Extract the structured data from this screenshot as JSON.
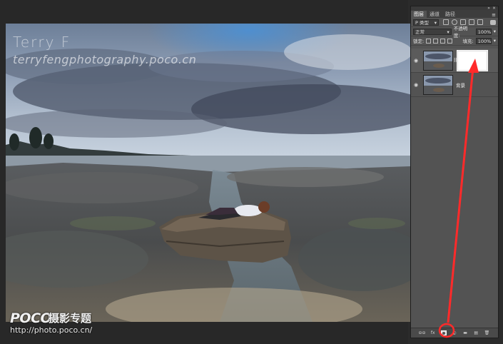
{
  "watermark": {
    "name": "Terry F",
    "url": "terryfengphotography.poco.cn"
  },
  "site_logo": {
    "brand": "POCO",
    "subtitle": "摄影专题",
    "url": "http://photo.poco.cn/"
  },
  "layers_panel": {
    "tabs": [
      "图层",
      "通道",
      "路径"
    ],
    "active_tab": "图层",
    "filter": {
      "kind_label": "P 类型"
    },
    "blend_mode": "正常",
    "opacity_label": "不透明度:",
    "opacity_value": "100%",
    "lock_label": "锁定:",
    "fill_label": "填充:",
    "fill_value": "100%",
    "layers": [
      {
        "name": "",
        "has_mask": true,
        "selected": true
      },
      {
        "name": "背景",
        "has_mask": false,
        "selected": false
      }
    ],
    "bottom_buttons": [
      "link-layers",
      "fx",
      "add-layer-mask",
      "adjustment-layer",
      "new-group",
      "new-layer",
      "delete-layer"
    ],
    "bottom_glyphs": [
      "⊖⊖",
      "fx",
      "",
      "◐",
      "▬",
      "▤",
      "🗑"
    ]
  },
  "colors": {
    "annotation_red": "#ff2a2a",
    "panel_bg": "#535353"
  },
  "icons": {
    "eye": "visibility-eye-icon",
    "chain": "mask-link-icon",
    "panel_menu": "panel-menu-icon"
  }
}
